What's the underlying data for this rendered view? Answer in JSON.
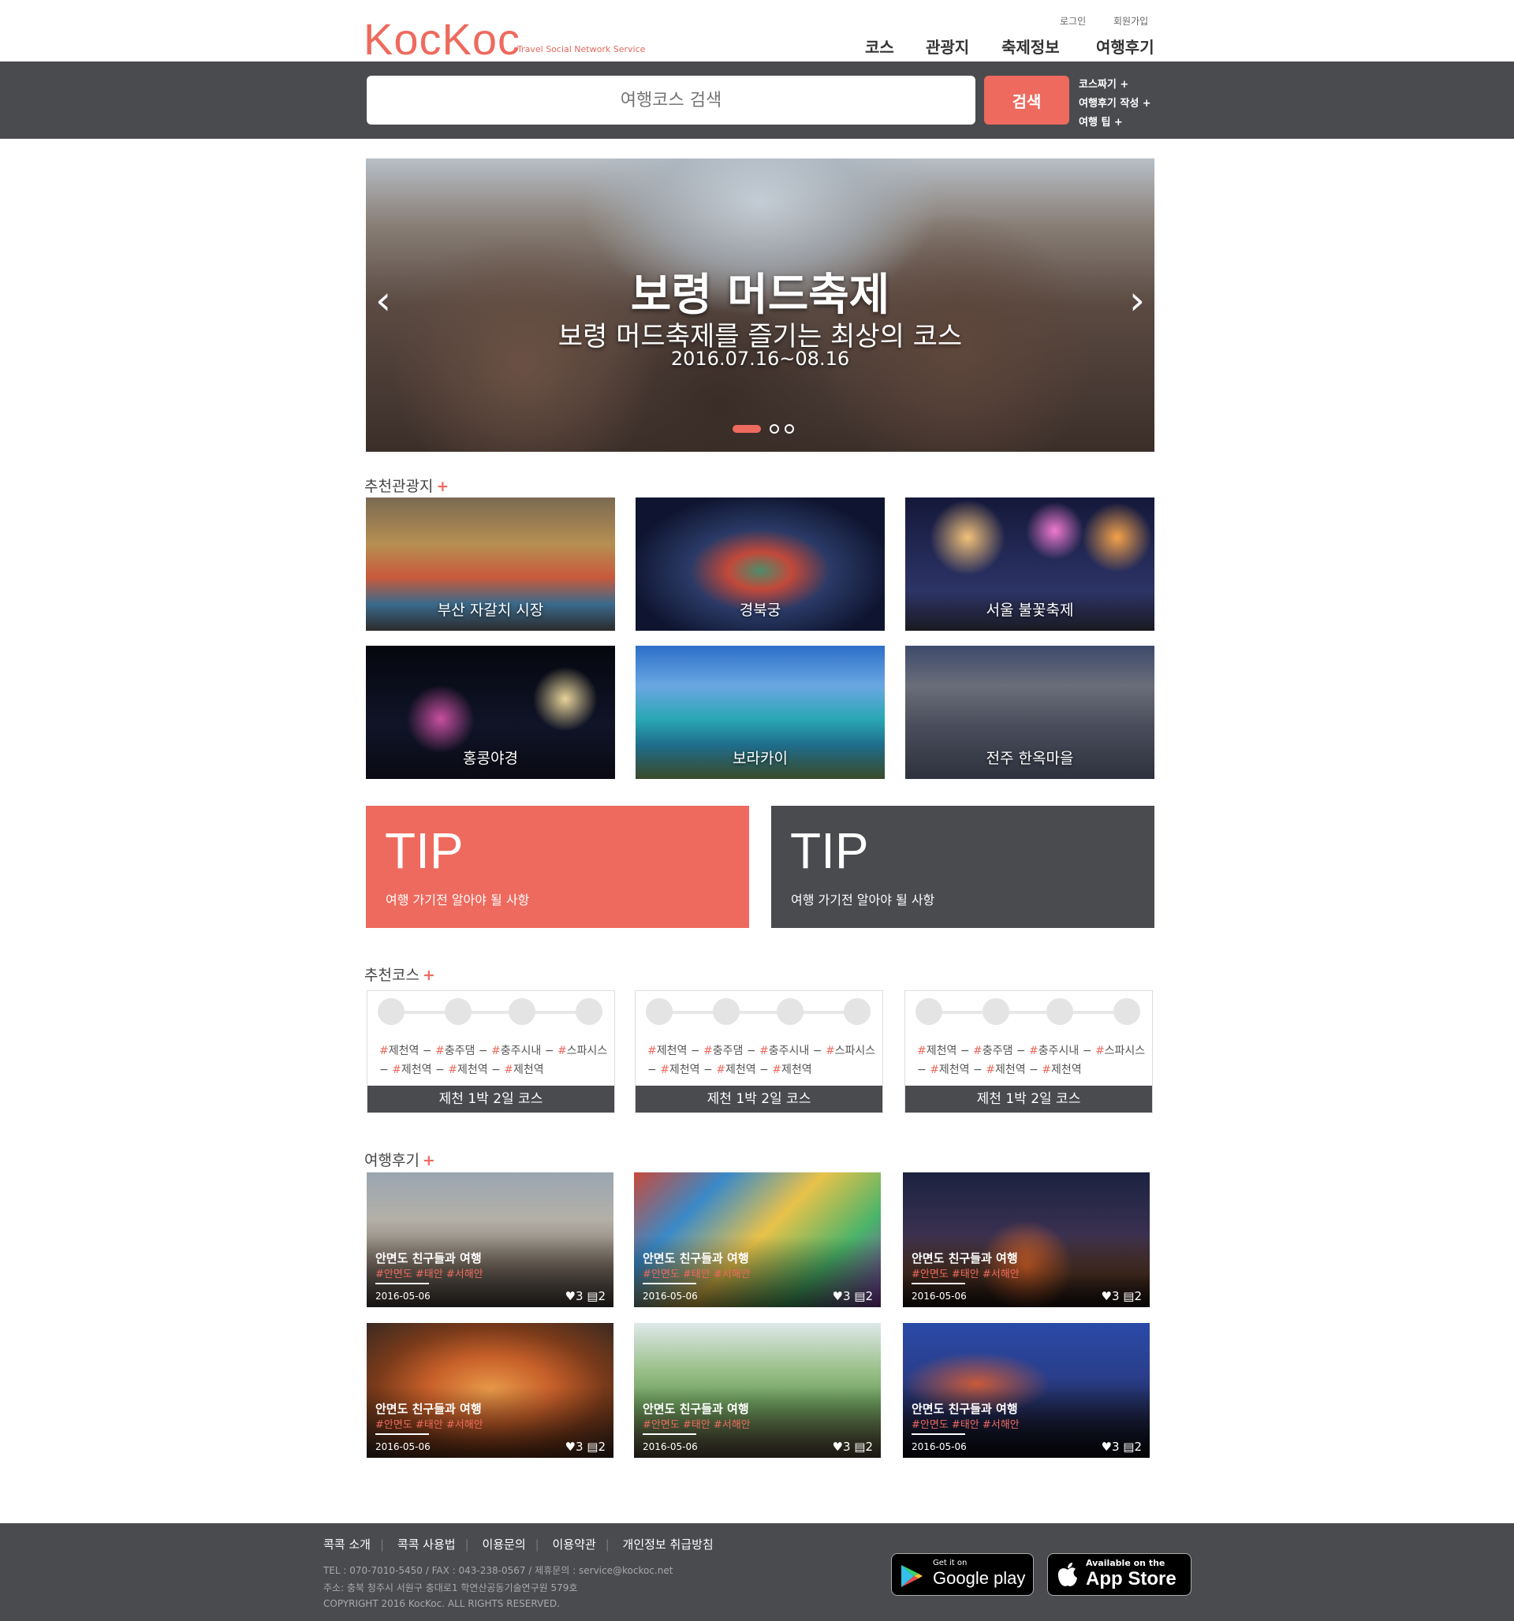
{
  "header": {
    "logo": "KocKoc",
    "logo_sub": "Travel Social Network Service",
    "login": "로그인",
    "signup": "회원가입",
    "nav": [
      "코스",
      "관광지",
      "축제정보",
      "여행후기"
    ]
  },
  "search": {
    "placeholder": "여행코스 검색",
    "button": "검색",
    "quick_links": [
      "코스짜기 +",
      "여행후기 작성 +",
      "여행 팁 +"
    ]
  },
  "hero": {
    "title": "보령 머드축제",
    "subtitle": "보령 머드축제를 즐기는 최상의 코스",
    "date": "2016.07.16~08.16",
    "slides": 3,
    "active_slide": 1
  },
  "attractions": {
    "title": "추천관광지",
    "plus": "+",
    "items": [
      "부산 자갈치 시장",
      "경북궁",
      "서울 불꽃축제",
      "홍콩야경",
      "보라카이",
      "전주 한옥마을"
    ]
  },
  "tips": [
    {
      "title": "TIP",
      "subtitle": "여행 가기전 알아야 될 사항",
      "color": "#ee6a5e"
    },
    {
      "title": "TIP",
      "subtitle": "여행 가기전 알아야 될 사항",
      "color": "#4a4b4f"
    }
  ],
  "courses": {
    "title": "추천코스",
    "plus": "+",
    "items": [
      {
        "line1": [
          "제천역",
          "충주댐",
          "충주시내",
          "스파시스"
        ],
        "line2": [
          "제천역",
          "제천역",
          "제천역"
        ],
        "name": "제천 1박 2일 코스"
      },
      {
        "line1": [
          "제천역",
          "충주댐",
          "충주시내",
          "스파시스"
        ],
        "line2": [
          "제천역",
          "제천역",
          "제천역"
        ],
        "name": "제천 1박 2일 코스"
      },
      {
        "line1": [
          "제천역",
          "충주댐",
          "충주시내",
          "스파시스"
        ],
        "line2": [
          "제천역",
          "제천역",
          "제천역"
        ],
        "name": "제천 1박 2일 코스"
      }
    ]
  },
  "reviews": {
    "title": "여행후기",
    "plus": "+",
    "items": [
      {
        "title": "안면도 친구들과 여행",
        "tags": "#안면도 #태안 #서해안",
        "date": "2016-05-06",
        "likes": "3",
        "comments": "2"
      },
      {
        "title": "안면도 친구들과 여행",
        "tags": "#안면도 #태안 #서해안",
        "date": "2016-05-06",
        "likes": "3",
        "comments": "2"
      },
      {
        "title": "안면도 친구들과 여행",
        "tags": "#안면도 #태안 #서해안",
        "date": "2016-05-06",
        "likes": "3",
        "comments": "2"
      },
      {
        "title": "안면도 친구들과 여행",
        "tags": "#안면도 #태안 #서해안",
        "date": "2016-05-06",
        "likes": "3",
        "comments": "2"
      },
      {
        "title": "안면도 친구들과 여행",
        "tags": "#안면도 #태안 #서해안",
        "date": "2016-05-06",
        "likes": "3",
        "comments": "2"
      },
      {
        "title": "안면도 친구들과 여행",
        "tags": "#안면도 #태안 #서해안",
        "date": "2016-05-06",
        "likes": "3",
        "comments": "2"
      }
    ]
  },
  "footer": {
    "links": [
      "콕콕 소개",
      "콕콕 사용법",
      "이용문의",
      "이용약관",
      "개인정보 취급방침"
    ],
    "contact": "TEL : 070-7010-5450 / FAX : 043-238-0567 / 제휴문의 : service@kockoc.net",
    "address": "주소: 충북 청주시 서원구 충대로1 학연산공동기술연구원 579호",
    "copyright": "COPYRIGHT 2016 KocKoc. ALL RIGHTS RESERVED.",
    "google_play": {
      "small": "Get it on",
      "big": "Google play"
    },
    "app_store": {
      "small": "Available on the",
      "big": "App Store"
    }
  },
  "colors": {
    "accent": "#ee6a5e",
    "dark": "#4a4b4f"
  }
}
